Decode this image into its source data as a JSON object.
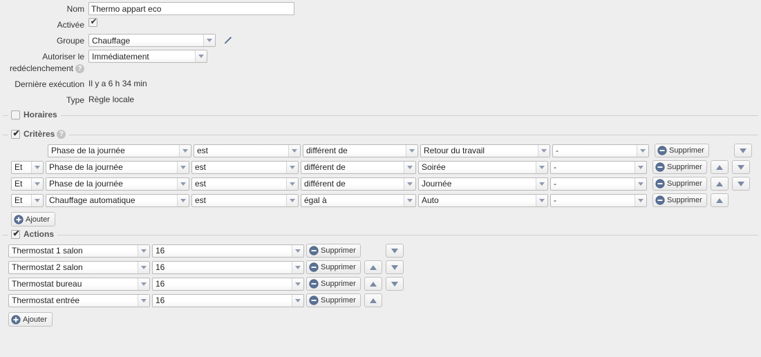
{
  "form": {
    "name_label": "Nom",
    "name_value": "Thermo appart eco",
    "enabled_label": "Activée",
    "enabled_checked": true,
    "group_label": "Groupe",
    "group_value": "Chauffage",
    "edit_group_icon": "pencil-icon",
    "retrigger_label_line1": "Autoriser le",
    "retrigger_label_line2": "redéclenchement",
    "retrigger_help": "?",
    "retrigger_value": "Immédiatement",
    "last_exec_label": "Dernière exécution",
    "last_exec_value": "Il y a 6 h 34 min",
    "type_label": "Type",
    "type_value": "Règle locale"
  },
  "schedules": {
    "legend": "Horaires",
    "checked": false
  },
  "criteria": {
    "legend": "Critères",
    "checked": true,
    "help": "?",
    "add_label": "Ajouter",
    "delete_label": "Supprimer",
    "rows": [
      {
        "logic": "",
        "field": "Phase de la journée",
        "operator": "est",
        "comparator": "différent de",
        "value": "Retour du travail",
        "extra": "-",
        "has_up": false,
        "has_down": true
      },
      {
        "logic": "Et",
        "field": "Phase de la journée",
        "operator": "est",
        "comparator": "différent de",
        "value": "Soirée",
        "extra": "-",
        "has_up": true,
        "has_down": true
      },
      {
        "logic": "Et",
        "field": "Phase de la journée",
        "operator": "est",
        "comparator": "différent de",
        "value": "Journée",
        "extra": "-",
        "has_up": true,
        "has_down": true
      },
      {
        "logic": "Et",
        "field": "Chauffage automatique",
        "operator": "est",
        "comparator": "égal à",
        "value": "Auto",
        "extra": "-",
        "has_up": true,
        "has_down": false
      }
    ]
  },
  "actions": {
    "legend": "Actions",
    "checked": true,
    "add_label": "Ajouter",
    "delete_label": "Supprimer",
    "rows": [
      {
        "device": "Thermostat 1 salon",
        "value": "16",
        "has_up": false,
        "has_down": true
      },
      {
        "device": "Thermostat 2 salon",
        "value": "16",
        "has_up": true,
        "has_down": true
      },
      {
        "device": "Thermostat bureau",
        "value": "16",
        "has_up": true,
        "has_down": true
      },
      {
        "device": "Thermostat entrée",
        "value": "16",
        "has_up": true,
        "has_down": false
      }
    ]
  },
  "colors": {
    "page_bg": "#eeeeee",
    "accent_icon": "#5b7296",
    "arrow_blue": "#7b8aa5",
    "legend_text": "#555555",
    "divider": "#cfcfcf"
  }
}
